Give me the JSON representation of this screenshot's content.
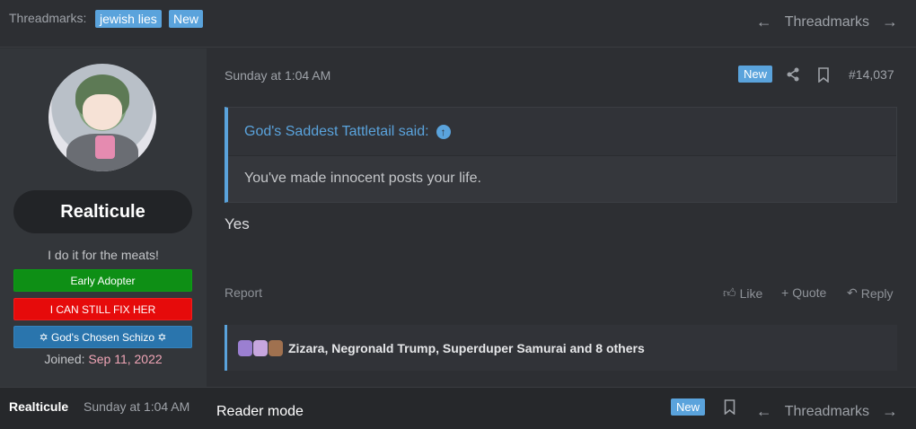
{
  "topbar": {
    "threadmarks_label": "Threadmarks:",
    "tag": "jewish lies",
    "new_badge": "New",
    "nav_label": "Threadmarks",
    "prev_icon": "arrow-left-icon",
    "next_icon": "arrow-right-icon"
  },
  "user": {
    "name": "Realticule",
    "title": "I do it for the meats!",
    "banners": [
      "Early Adopter",
      "I CAN STILL FIX HER",
      "✡ God's Chosen Schizo ✡"
    ],
    "joined_label": "Joined:",
    "joined_date": "Sep 11, 2022"
  },
  "post": {
    "date": "Sunday at 1:04 AM",
    "new_badge": "New",
    "number": "#14,037",
    "quote_author": "God's Saddest Tattletail said:",
    "quote_text": "You've made innocent posts your life.",
    "message": "Yes",
    "actions": {
      "report": "Report",
      "like": "Like",
      "quote": "Quote",
      "reply": "Reply"
    },
    "reactions_text": "Zizara, Negronald Trump, Superduper Samurai and 8 others"
  },
  "bottombar": {
    "user": "Realticule",
    "date": "Sunday at 1:04 AM",
    "reader_mode": "Reader mode",
    "new_badge": "New",
    "nav_label": "Threadmarks"
  },
  "colors": {
    "accent": "#5aa3dc",
    "early_adopter": "#0e8f15",
    "fix_her": "#e60b0b",
    "schizo": "#2a75ad"
  }
}
